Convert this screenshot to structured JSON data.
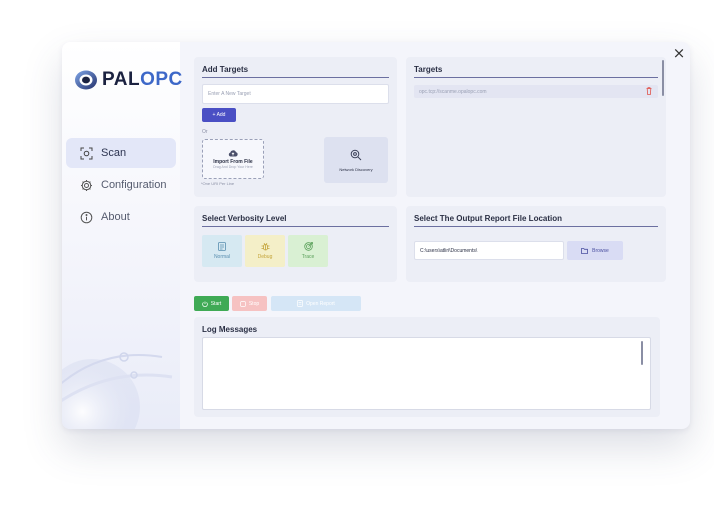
{
  "app": {
    "logo_text_1": "O",
    "logo_text_2": "PAL",
    "logo_text_3": "OPC"
  },
  "window": {
    "close_label": "×"
  },
  "sidebar": {
    "items": [
      {
        "label": "Scan",
        "icon": "scan-icon",
        "active": true
      },
      {
        "label": "Configuration",
        "icon": "gear-icon",
        "active": false
      },
      {
        "label": "About",
        "icon": "info-icon",
        "active": false
      }
    ]
  },
  "add_targets": {
    "title": "Add Targets",
    "input_placeholder": "Enter A New Target",
    "add_label": "+ Add",
    "or_label": "Or",
    "import_title": "Import From File",
    "import_hint": "Drag And Drop Your Here",
    "file_hint": "*One URI Per Line",
    "network_discovery_label": "Network Discovery"
  },
  "targets": {
    "title": "Targets",
    "items": [
      "opc.tcp://scanme.opalopc.com"
    ]
  },
  "verbosity": {
    "title": "Select Verbosity Level",
    "options": [
      {
        "label": "Normal",
        "bg": "#d6e9f2",
        "fg": "#5a8fb0"
      },
      {
        "label": "Debug",
        "bg": "#f4efc8",
        "fg": "#c4a43a"
      },
      {
        "label": "Trace",
        "bg": "#d9f0d3",
        "fg": "#5aa05a"
      }
    ]
  },
  "output": {
    "title": "Select The Output Report File Location",
    "path_value": "C:\\users\\atliri\\Documents\\",
    "browse_label": "Browse"
  },
  "controls": {
    "start_label": "Start",
    "stop_label": "Stop",
    "open_report_label": "Open Report",
    "start_color": "#3faa55",
    "stop_color": "#f6c2c2",
    "open_report_color": "#d5e6f6"
  },
  "log": {
    "title": "Log Messages"
  },
  "colors": {
    "accent": "#4a4fc4",
    "brand_blue": "#3d68c8",
    "delete": "#e0524a"
  }
}
